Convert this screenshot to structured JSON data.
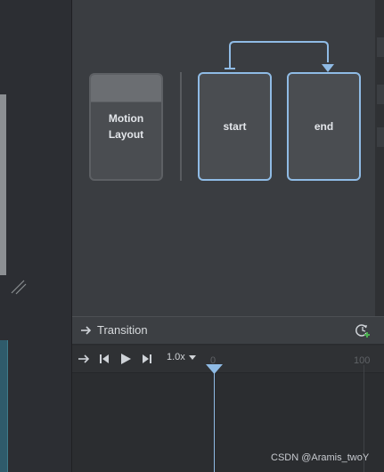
{
  "graph": {
    "motion_layout_label": "Motion\nLayout",
    "start_label": "start",
    "end_label": "end",
    "accent_color": "#8fbbe5"
  },
  "transition_panel": {
    "title": "Transition",
    "speed": "1.0x",
    "ruler_start": "0",
    "ruler_end": "100",
    "icons": {
      "header": "arrow-right-icon",
      "add_cycle": "add-cycle-icon",
      "loop": "loop-arrow-icon",
      "skip_start": "skip-to-start-icon",
      "play": "play-icon",
      "skip_end": "skip-to-end-icon"
    }
  },
  "watermark": "CSDN @Aramis_twoY"
}
